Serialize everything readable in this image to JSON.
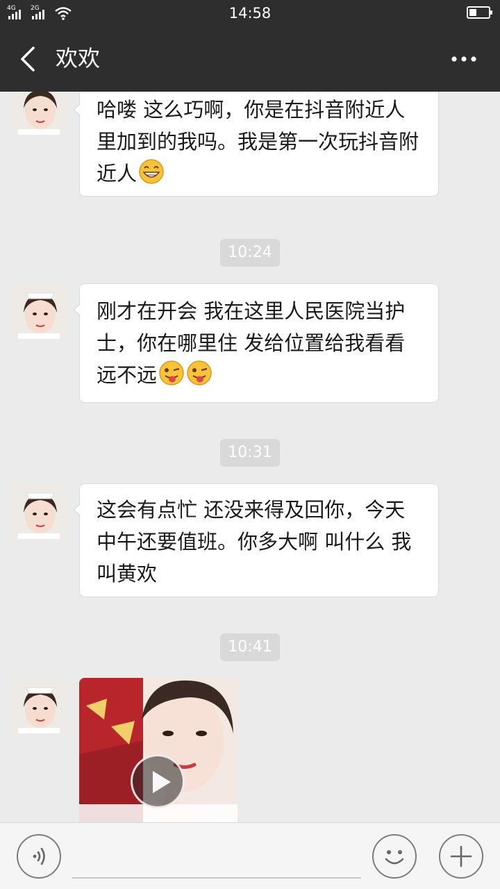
{
  "status_bar": {
    "signal1_label": "4G",
    "signal2_label": "2G",
    "time": "14:58",
    "battery_level": 0.4
  },
  "header": {
    "title": "欢欢",
    "back_icon": "chevron-left-icon",
    "more_icon": "more-dots-icon"
  },
  "messages": [
    {
      "sender": "欢欢",
      "type": "text",
      "text": "哈喽  这么巧啊，你是在抖音附近人里加到的我吗。我是第一次玩抖音附近人",
      "emoji": [
        "grinning-face"
      ]
    },
    {
      "type": "timestamp",
      "text": "10:24"
    },
    {
      "sender": "欢欢",
      "type": "text",
      "text": "刚才在开会 我在这里人民医院当护士，你在哪里住 发给位置给我看看远不远",
      "emoji": [
        "winking-tongue-face",
        "winking-tongue-face"
      ]
    },
    {
      "type": "timestamp",
      "text": "10:31"
    },
    {
      "sender": "欢欢",
      "type": "text",
      "text": "这会有点忙 还没来得及回你，今天中午还要值班。你多大啊 叫什么 我叫黄欢"
    },
    {
      "type": "timestamp",
      "text": "10:41"
    },
    {
      "sender": "欢欢",
      "type": "video"
    }
  ],
  "input_bar": {
    "voice_icon": "voice-icon",
    "emoji_icon": "smiley-icon",
    "plus_icon": "plus-icon",
    "text_value": ""
  },
  "colors": {
    "header_bg": "#2e2e2e",
    "chat_bg": "#ebebeb",
    "bubble_bg": "#ffffff",
    "timestamp_bg": "#d9d9d9"
  }
}
